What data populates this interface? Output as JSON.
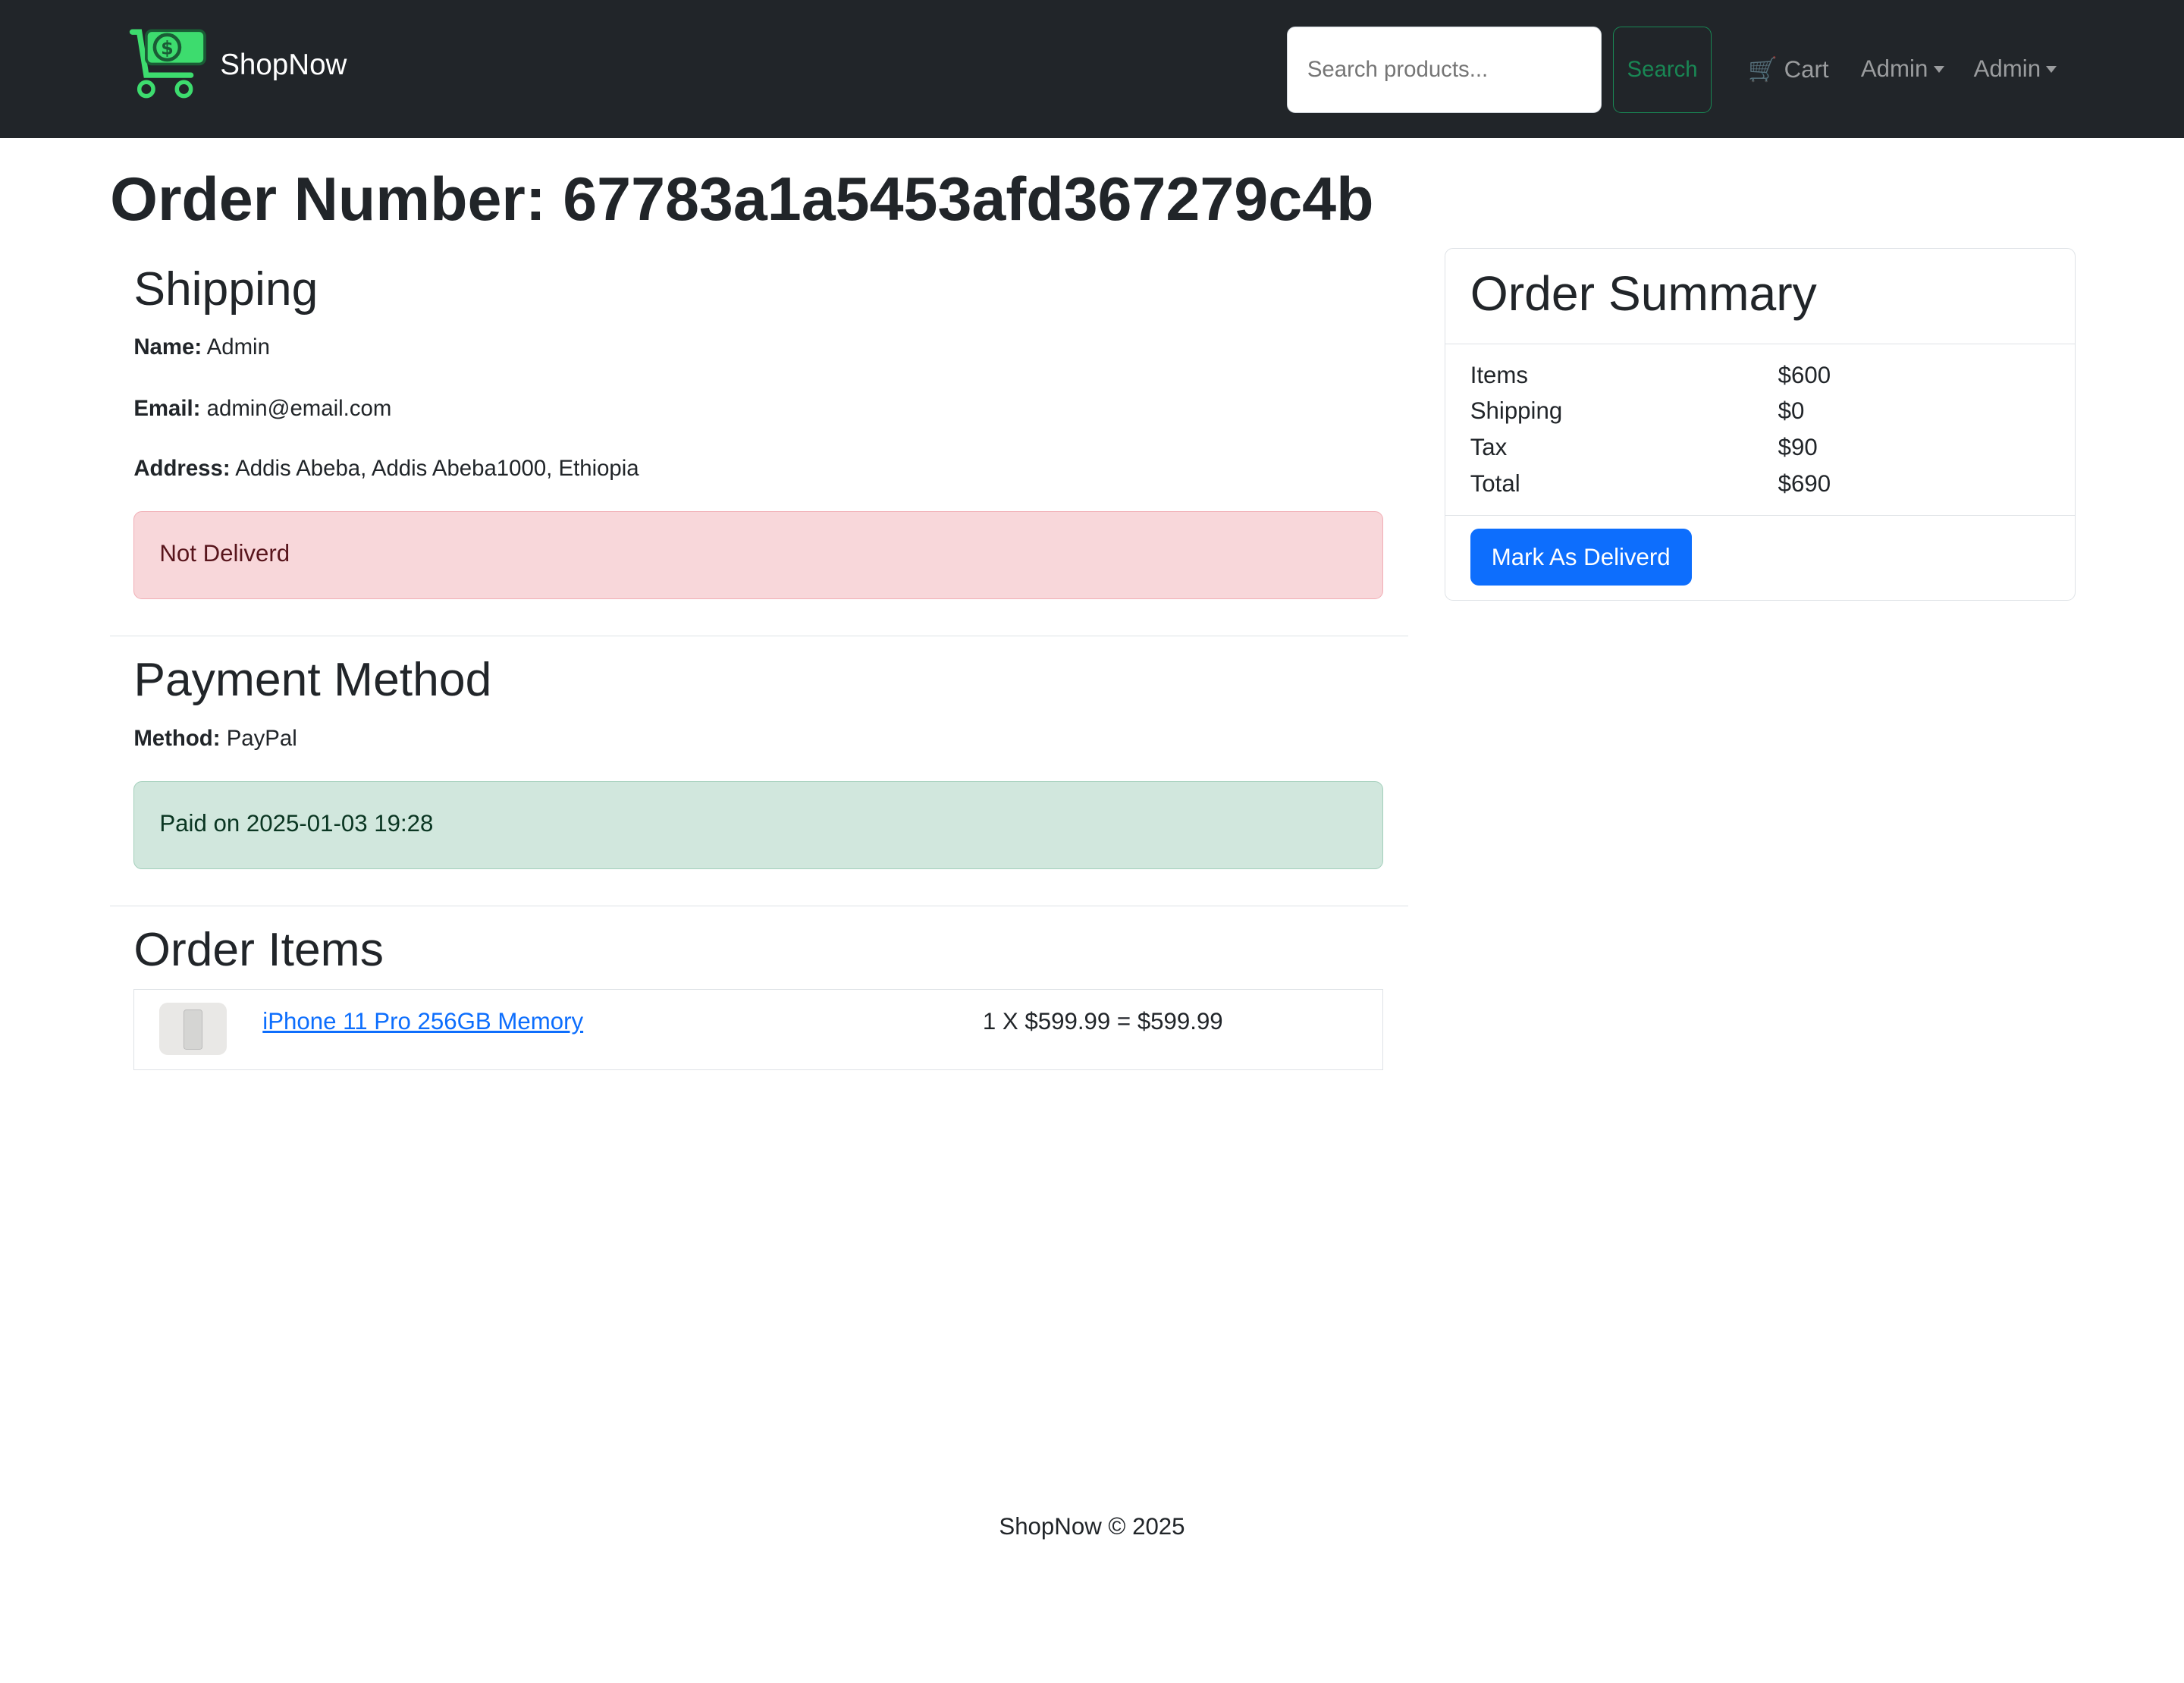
{
  "nav": {
    "brand": "ShopNow",
    "search_placeholder": "Search products...",
    "search_button": "Search",
    "cart": "Cart",
    "menu1": "Admin",
    "menu2": "Admin"
  },
  "order": {
    "title": "Order Number: 67783a1a5453afd367279c4b"
  },
  "shipping": {
    "heading": "Shipping",
    "name_label": "Name:",
    "name": "Admin",
    "email_label": "Email:",
    "email": "admin@email.com",
    "address_label": "Address:",
    "address": "Addis Abeba, Addis Abeba1000, Ethiopia",
    "status": "Not Deliverd"
  },
  "payment": {
    "heading": "Payment Method",
    "method_label": "Method:",
    "method": "PayPal",
    "status": "Paid on 2025-01-03 19:28"
  },
  "items": {
    "heading": "Order Items",
    "list": [
      {
        "name": "iPhone 11 Pro 256GB Memory",
        "calc": "1 X $599.99 = $599.99"
      }
    ]
  },
  "summary": {
    "heading": "Order Summary",
    "rows": [
      {
        "label": "Items",
        "value": "$600"
      },
      {
        "label": "Shipping",
        "value": "$0"
      },
      {
        "label": "Tax",
        "value": "$90"
      },
      {
        "label": "Total",
        "value": "$690"
      }
    ],
    "button": "Mark As Deliverd"
  },
  "footer": {
    "text": "ShopNow © 2025"
  }
}
